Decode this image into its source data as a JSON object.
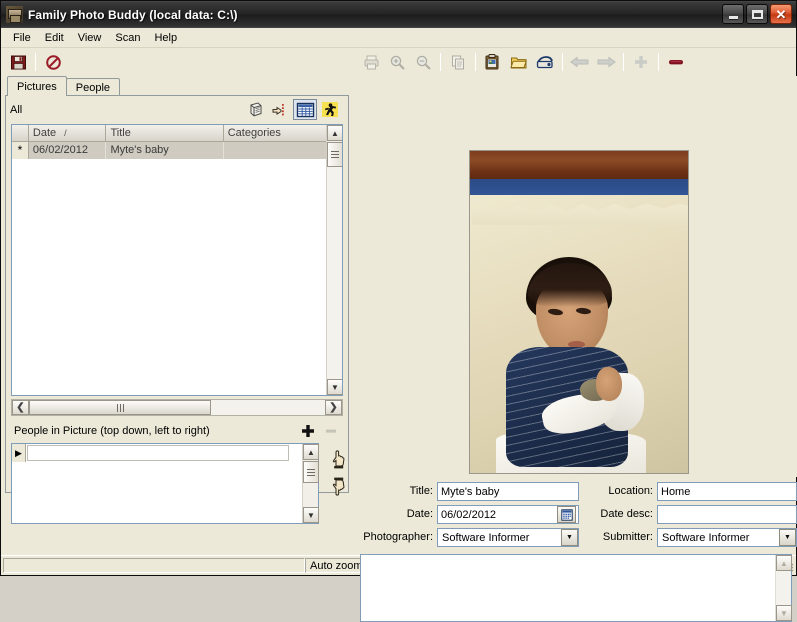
{
  "window": {
    "title": "Family Photo Buddy (local data: C:\\)",
    "icon": "app-photo-icon",
    "buttons": {
      "minimize": "minimize",
      "maximize": "maximize",
      "close": "close"
    }
  },
  "menubar": {
    "items": [
      {
        "label": "File"
      },
      {
        "label": "Edit"
      },
      {
        "label": "View"
      },
      {
        "label": "Scan"
      },
      {
        "label": "Help"
      }
    ]
  },
  "toolbar": {
    "buttons": [
      {
        "name": "save-icon",
        "label": "Save",
        "enabled": true
      },
      {
        "name": "cancel-icon",
        "label": "Cancel",
        "enabled": true
      },
      {
        "name": "print-icon",
        "label": "Print",
        "enabled": false
      },
      {
        "name": "zoom-in-icon",
        "label": "Zoom In",
        "enabled": false
      },
      {
        "name": "zoom-out-icon",
        "label": "Zoom Out",
        "enabled": false
      },
      {
        "name": "copy-icon",
        "label": "Copy",
        "enabled": false
      },
      {
        "name": "paste-picture-icon",
        "label": "Paste Picture",
        "enabled": true
      },
      {
        "name": "open-folder-icon",
        "label": "Open Folder",
        "enabled": true
      },
      {
        "name": "scanner-icon",
        "label": "Scan",
        "enabled": true
      },
      {
        "name": "back-arrow-icon",
        "label": "Previous",
        "enabled": false
      },
      {
        "name": "forward-arrow-icon",
        "label": "Next",
        "enabled": false
      },
      {
        "name": "add-icon",
        "label": "Add",
        "enabled": false
      },
      {
        "name": "delete-icon",
        "label": "Delete",
        "enabled": true
      }
    ]
  },
  "tabs": [
    {
      "label": "Pictures",
      "active": true
    },
    {
      "label": "People",
      "active": false
    }
  ],
  "pictures_panel": {
    "filter_label": "All",
    "view_buttons": [
      {
        "name": "cube-icon",
        "label": "Objects",
        "pressed": false
      },
      {
        "name": "hand-point-icon",
        "label": "Assign",
        "pressed": false
      },
      {
        "name": "grid-view-icon",
        "label": "Grid View",
        "pressed": true
      },
      {
        "name": "person-running-icon",
        "label": "People View",
        "pressed": false
      }
    ],
    "grid": {
      "columns": [
        "",
        "Date",
        "Title",
        "Categories"
      ],
      "sort_indicator": "/",
      "rows": [
        {
          "marker": "*",
          "date": "06/02/2012",
          "title": "Myte's baby",
          "categories": "",
          "selected": true
        }
      ]
    }
  },
  "people_in_picture": {
    "label": "People in Picture (top down, left to right)",
    "add_button": "+",
    "remove_button": "–",
    "row_marker": "▶",
    "rows": [
      {
        "name": ""
      }
    ],
    "move_up_label": "Move Up",
    "move_down_label": "Move Down"
  },
  "details": {
    "title": {
      "label": "Title:",
      "value": "Myte's baby"
    },
    "location": {
      "label": "Location:",
      "value": "Home"
    },
    "date": {
      "label": "Date:",
      "value": "06/02/2012"
    },
    "date_desc": {
      "label": "Date desc:",
      "value": ""
    },
    "photographer": {
      "label": "Photographer:",
      "value": "Software Informer",
      "options": [
        "Software Informer"
      ]
    },
    "submitter": {
      "label": "Submitter:",
      "value": "Software Informer",
      "options": [
        "Software Informer"
      ]
    },
    "notes": {
      "value": ""
    }
  },
  "photo": {
    "alt": "Toddler in navy striped sweater holding a small round object"
  },
  "statusbar": {
    "panel1": "",
    "panel2": "Auto zoom",
    "panel3": ""
  },
  "colors": {
    "window_face": "#ece9d8",
    "titlebar": "#242424",
    "close_button": "#c33a12",
    "field_border": "#7f9db9",
    "selection": "#d0cbc0"
  }
}
